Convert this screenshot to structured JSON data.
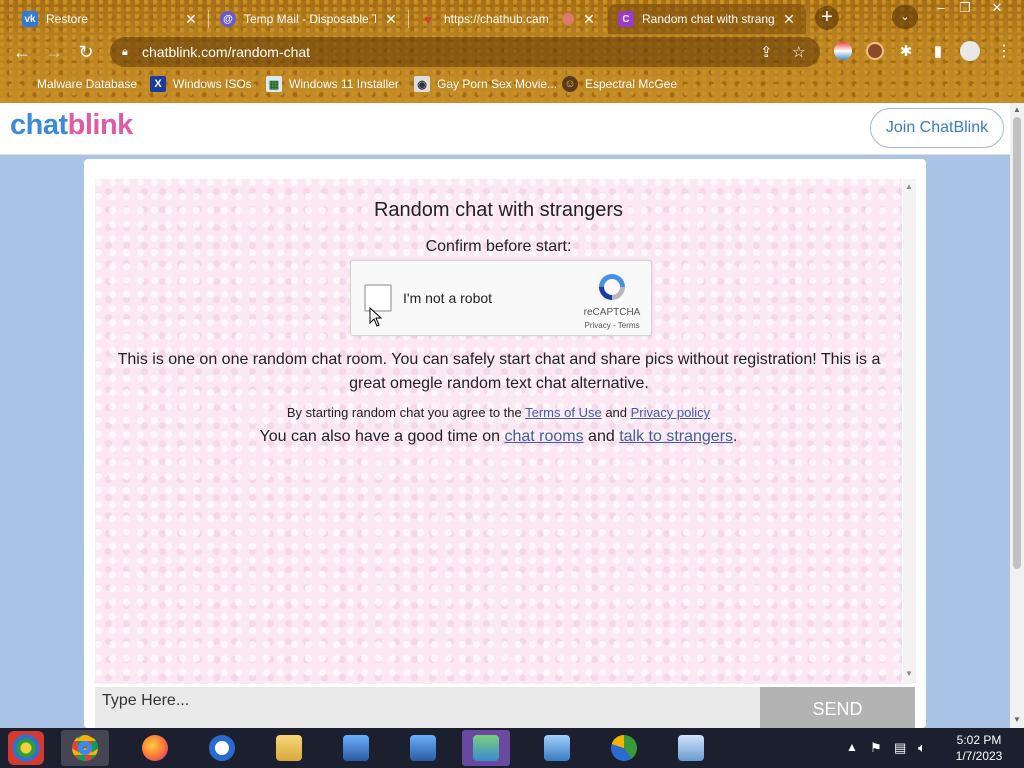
{
  "browser": {
    "tabs": [
      {
        "title": "Restore",
        "favicon": "vk-icon",
        "color": "#2f7ad8",
        "glyph": "vk"
      },
      {
        "title": "Temp Mail - Disposable Te",
        "favicon": "tempmail-icon",
        "color": "#6a5acd",
        "glyph": "@"
      },
      {
        "title": "https://chathub.cam",
        "favicon": "chathub-icon",
        "color": "#d43a2f",
        "glyph": "♥"
      },
      {
        "title": "Random chat with strange",
        "favicon": "chatblink-icon",
        "color": "#9b3cc4",
        "glyph": "C"
      }
    ],
    "url": "chatblink.com/random-chat",
    "bookmarks": [
      {
        "label": "Malware Database",
        "icon": "bookmark-blank-icon"
      },
      {
        "label": "Windows ISOs",
        "icon": "x-icon"
      },
      {
        "label": "Windows 11 Installer",
        "icon": "installer-icon"
      },
      {
        "label": "Gay Porn Sex Movie...",
        "icon": "site-icon"
      },
      {
        "label": "Espectral McGee",
        "icon": "avatar-icon"
      }
    ]
  },
  "site": {
    "logo_part1": "chat",
    "logo_part2": "blink",
    "join_label": "Join ChatBlink"
  },
  "chat": {
    "title": "Random chat with strangers",
    "confirm": "Confirm before start:",
    "captcha": {
      "label": "I'm not a robot",
      "brand": "reCAPTCHA",
      "privacy": "Privacy",
      "sep": " - ",
      "terms": "Terms"
    },
    "description": "This is one on one random chat room. You can safely start chat and share pics without registration! This is a great omegle random text chat alternative.",
    "agree_prefix": "By starting random chat you agree to the ",
    "terms_link": "Terms of Use",
    "agree_and": " and ",
    "privacy_link": "Privacy policy",
    "also_prefix": "You can also have a good time on ",
    "rooms_link": "chat rooms",
    "also_and": " and ",
    "strangers_link": "talk to strangers",
    "also_suffix": ".",
    "input_placeholder": "Type Here...",
    "send_label": "SEND"
  },
  "taskbar": {
    "time": "5:02 PM",
    "date": "1/7/2023"
  },
  "colors": {
    "accent_blue": "#3c8ad9",
    "accent_pink": "#e05aa8",
    "chat_bg": "#fbe8f3"
  }
}
